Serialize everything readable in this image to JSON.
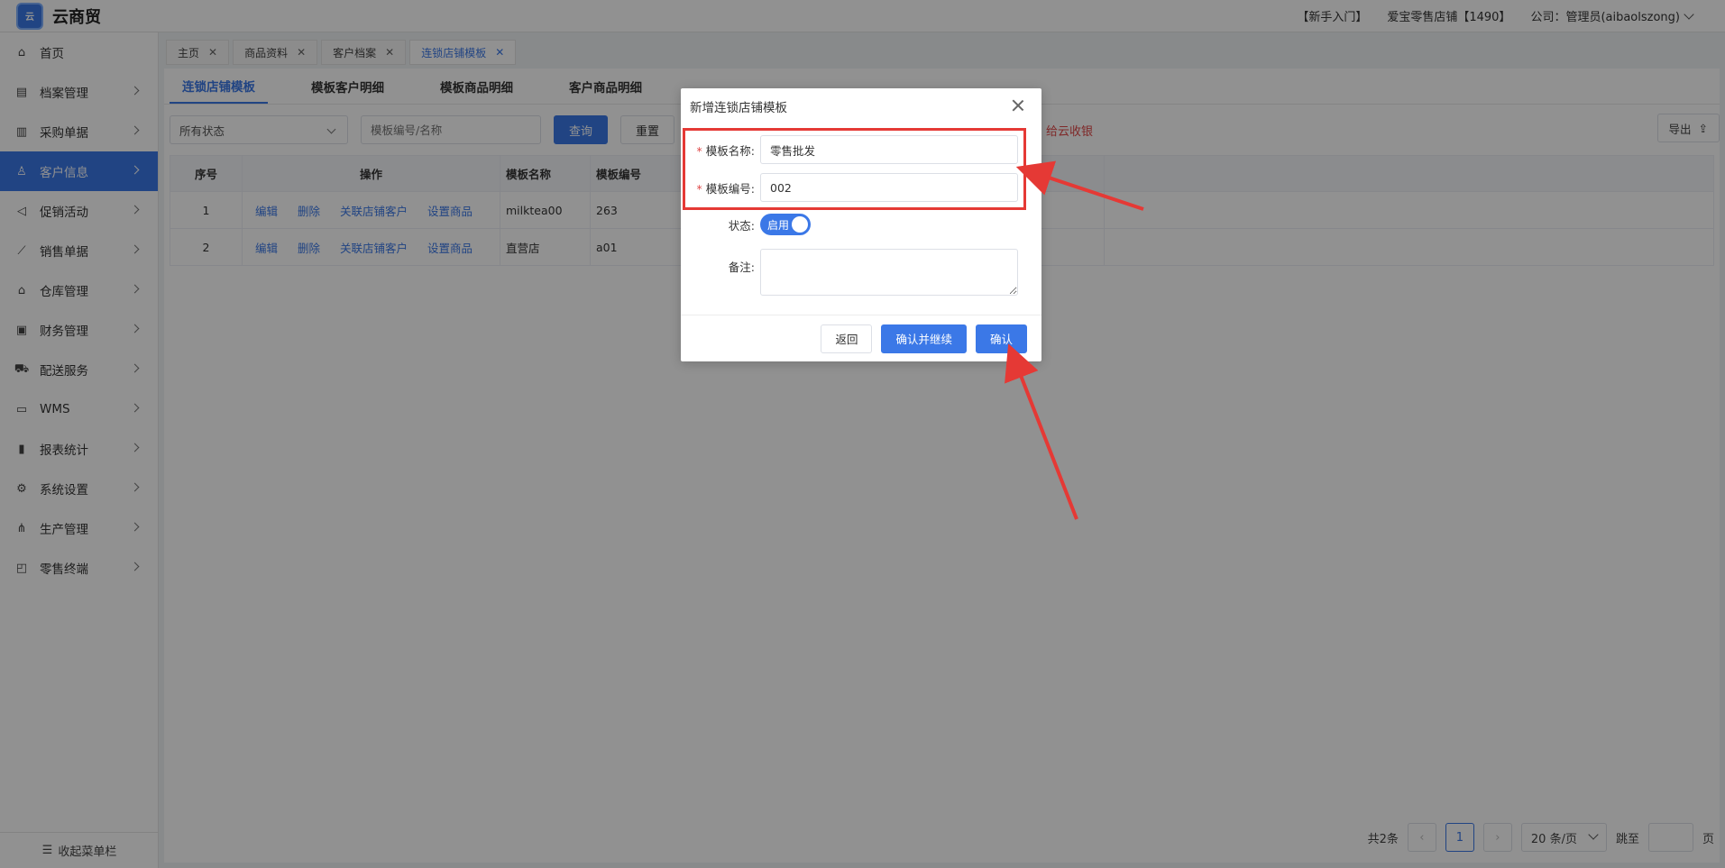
{
  "app": {
    "title": "云商贸",
    "logo_badge": "云"
  },
  "topbar": {
    "guide": "【新手入门】",
    "store": "爱宝零售店铺【1490】",
    "company": "公司：管理员(aibaolszong)"
  },
  "sidebar": {
    "items": [
      {
        "label": "首页",
        "icon": "home-icon",
        "glyph": "⌂",
        "active": false,
        "arrow": false
      },
      {
        "label": "档案管理",
        "icon": "archive-icon",
        "glyph": "▤",
        "active": false,
        "arrow": true
      },
      {
        "label": "采购单据",
        "icon": "document-icon",
        "glyph": "▥",
        "active": false,
        "arrow": true
      },
      {
        "label": "客户信息",
        "icon": "user-icon",
        "glyph": "♙",
        "active": true,
        "arrow": true
      },
      {
        "label": "促销活动",
        "icon": "megaphone-icon",
        "glyph": "◁",
        "active": false,
        "arrow": true
      },
      {
        "label": "销售单据",
        "icon": "chart-icon",
        "glyph": "⟋",
        "active": false,
        "arrow": true
      },
      {
        "label": "仓库管理",
        "icon": "warehouse-icon",
        "glyph": "⌂",
        "active": false,
        "arrow": true
      },
      {
        "label": "财务管理",
        "icon": "finance-icon",
        "glyph": "▣",
        "active": false,
        "arrow": true
      },
      {
        "label": "配送服务",
        "icon": "cart-icon",
        "glyph": "⛟",
        "active": false,
        "arrow": true
      },
      {
        "label": "WMS",
        "icon": "truck-icon",
        "glyph": "▭",
        "active": false,
        "arrow": true
      },
      {
        "label": "报表统计",
        "icon": "bar-chart-icon",
        "glyph": "▮",
        "active": false,
        "arrow": true
      },
      {
        "label": "系统设置",
        "icon": "gear-icon",
        "glyph": "⚙",
        "active": false,
        "arrow": true
      },
      {
        "label": "生产管理",
        "icon": "network-icon",
        "glyph": "⋔",
        "active": false,
        "arrow": true
      },
      {
        "label": "零售终端",
        "icon": "bag-icon",
        "glyph": "◰",
        "active": false,
        "arrow": true
      }
    ],
    "collapse": "收起菜单栏"
  },
  "page_tabs": [
    {
      "label": "主页",
      "active": false
    },
    {
      "label": "商品资料",
      "active": false
    },
    {
      "label": "客户档案",
      "active": false
    },
    {
      "label": "连锁店铺模板",
      "active": true
    }
  ],
  "sub_tabs": [
    {
      "label": "连锁店铺模板",
      "active": true
    },
    {
      "label": "模板客户明细",
      "active": false
    },
    {
      "label": "模板商品明细",
      "active": false
    },
    {
      "label": "客户商品明细",
      "active": false
    }
  ],
  "filter": {
    "status": "所有状态",
    "search_placeholder": "模板编号/名称",
    "query": "查询",
    "reset": "重置",
    "sync_link": "给云收银",
    "export": "导出"
  },
  "table": {
    "headers": [
      "序号",
      "操作",
      "模板名称",
      "模板编号"
    ],
    "actions": [
      "编辑",
      "删除",
      "关联店铺客户",
      "设置商品"
    ],
    "rows": [
      {
        "no": "1",
        "name": "milktea00",
        "code": "263"
      },
      {
        "no": "2",
        "name": "直营店",
        "code": "a01"
      }
    ]
  },
  "pager": {
    "total": "共2条",
    "page": "1",
    "size": "20 条/页",
    "jump": "跳至",
    "page_unit": "页"
  },
  "modal": {
    "title": "新增连锁店铺模板",
    "name_label": "模板名称:",
    "name_value": "零售批发",
    "code_label": "模板编号:",
    "code_value": "002",
    "status_label": "状态:",
    "status_value": "启用",
    "remark_label": "备注:",
    "back": "返回",
    "confirm_continue": "确认并继续",
    "confirm": "确认"
  },
  "colors": {
    "primary": "#3b78e7",
    "highlight": "#e53935"
  }
}
